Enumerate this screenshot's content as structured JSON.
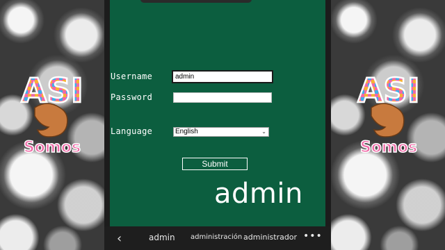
{
  "background": {
    "left_logo_icon": "asi-somos-flexed-arm-logo",
    "right_logo_icon": "asi-somos-flexed-arm-logo"
  },
  "logo": {
    "line1": "ASI",
    "line2": "Somos"
  },
  "colors": {
    "screen_bg": "#0c5e3f",
    "bar_bg": "#1e1e1e"
  },
  "form": {
    "username_label": "Username",
    "username_value": "admin",
    "password_label": "Password",
    "password_value": "",
    "language_label": "Language",
    "language_selected": "English",
    "submit_label": "Submit"
  },
  "overlay_text": "admin",
  "suggestions": {
    "back_icon": "chevron-left-icon",
    "items": [
      "admin",
      "administración",
      "administrador"
    ],
    "more_icon": "more-horizontal-icon"
  }
}
